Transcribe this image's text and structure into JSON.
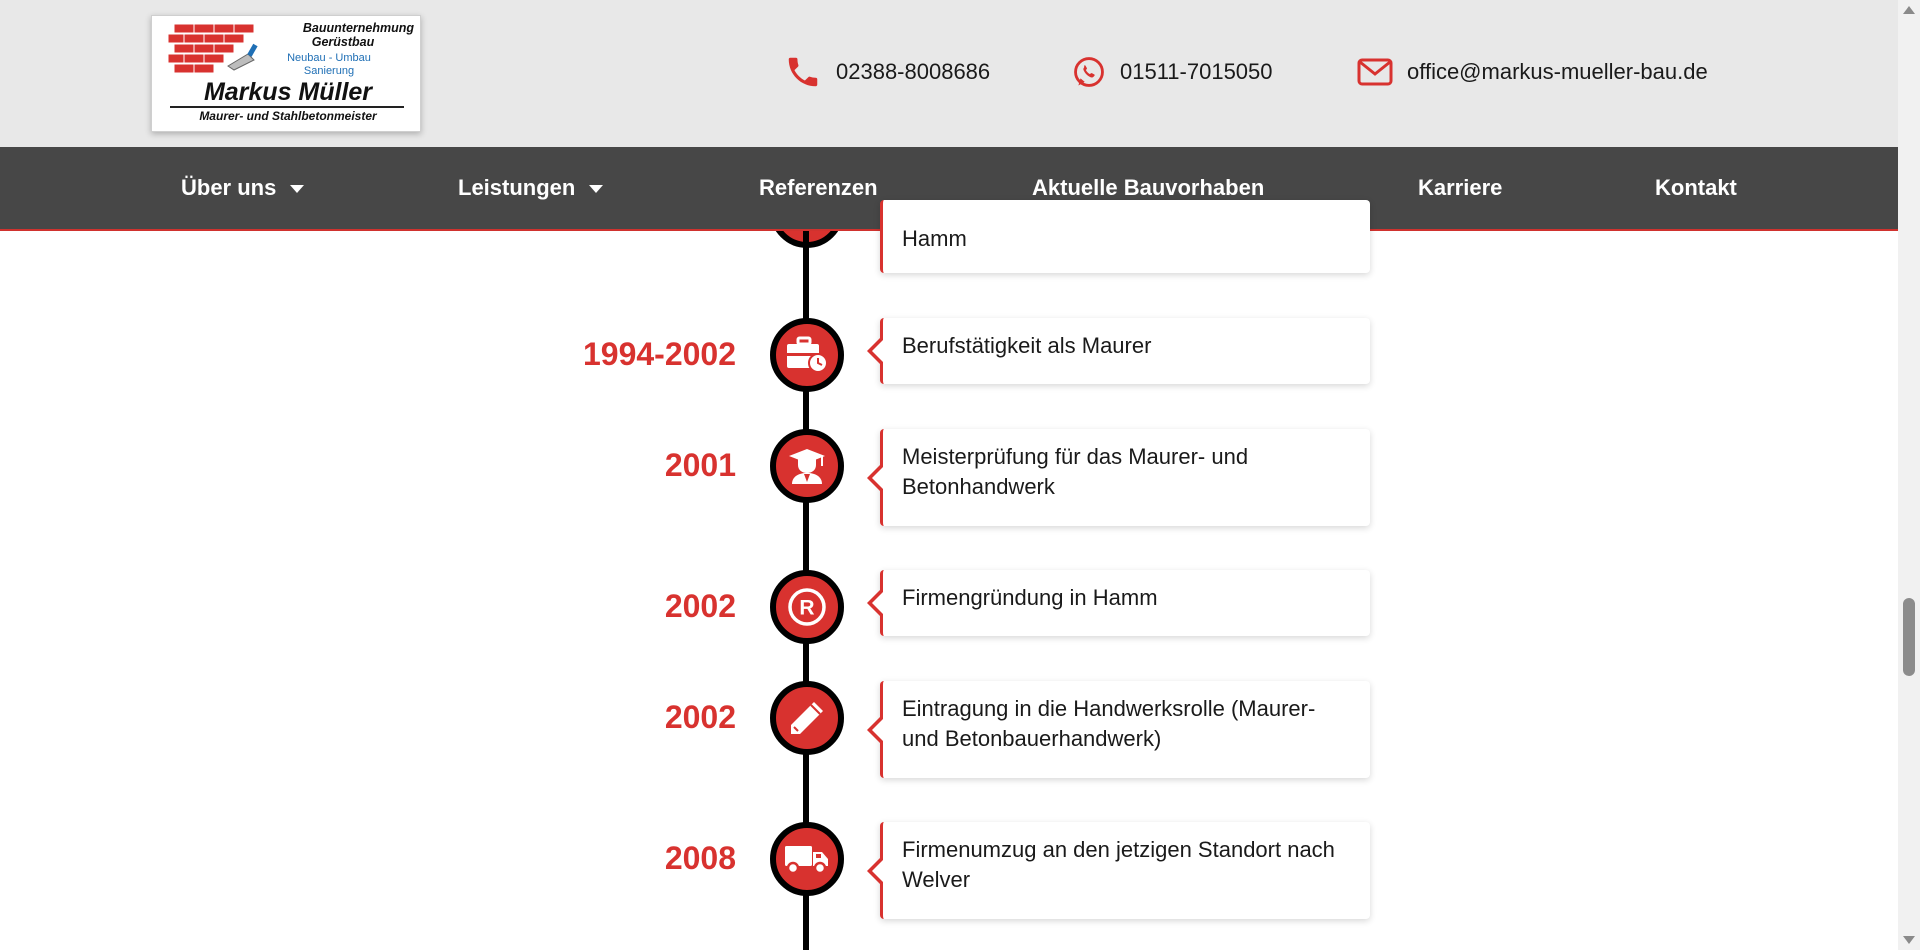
{
  "logo": {
    "line1": "Bauunternehmung",
    "line2": "Gerüstbau",
    "line3": "Neubau - Umbau",
    "line4": "Sanierung",
    "name": "Markus Müller",
    "tagline": "Maurer- und Stahlbetonmeister"
  },
  "contact": {
    "phone": "02388-8008686",
    "whatsapp": "01511-7015050",
    "email": "office@markus-mueller-bau.de"
  },
  "nav": {
    "items": [
      {
        "label": "Über uns",
        "dropdown": true
      },
      {
        "label": "Leistungen",
        "dropdown": true
      },
      {
        "label": "Referenzen"
      },
      {
        "label": "Aktuelle Bauvorhaben"
      },
      {
        "label": "Karriere"
      },
      {
        "label": "Kontakt"
      }
    ]
  },
  "timeline": {
    "partial_item": {
      "text": "Hamm"
    },
    "items": [
      {
        "year": "1994-2002",
        "text": "Berufstätigkeit als Maurer",
        "icon": "briefcase-clock-icon"
      },
      {
        "year": "2001",
        "text": "Meisterprüfung für das Maurer- und Betonhandwerk",
        "icon": "graduate-icon"
      },
      {
        "year": "2002",
        "text": "Firmengründung in Hamm",
        "icon": "registered-icon"
      },
      {
        "year": "2002",
        "text": "Eintragung in die Handwerksrolle (Maurer- und Betonbauerhandwerk)",
        "icon": "pencil-icon"
      },
      {
        "year": "2008",
        "text": "Firmenumzug an den jetzigen Standort nach Welver",
        "icon": "truck-icon"
      }
    ]
  },
  "colors": {
    "accent": "#d8322f",
    "nav_bg": "#474747",
    "topbar_bg": "#e8e8e8"
  }
}
